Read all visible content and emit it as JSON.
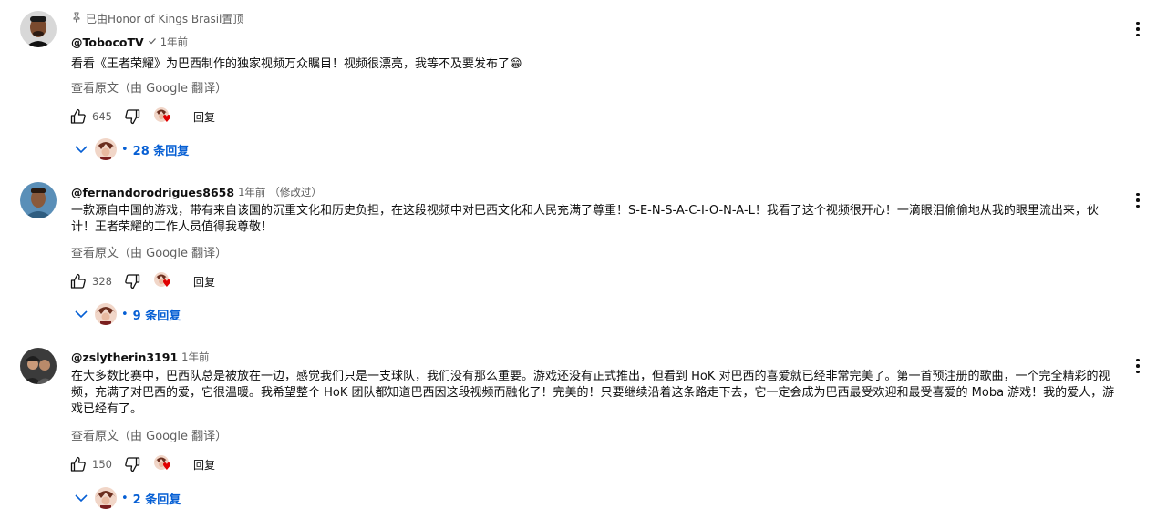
{
  "colors": {
    "link": "#065fd4",
    "secondary": "#606060",
    "primary": "#0f0f0f",
    "heart": "#e00000"
  },
  "comments": [
    {
      "pinned_text": "已由Honor of Kings Brasil置顶",
      "author": "@TobocoTV",
      "verified_icon": "check-icon",
      "time": "1年前",
      "edited": "",
      "text": "看看《王者荣耀》为巴西制作的独家视频万众瞩目！视频很漂亮，我等不及要发布了😁",
      "translate": "查看原文（由 Google 翻译）",
      "likes": "645",
      "reply_label": "回复",
      "replies": "28 条回复"
    },
    {
      "pinned_text": "",
      "author": "@fernandorodrigues8658",
      "time": "1年前",
      "edited": "（修改过）",
      "text": "一款源自中国的游戏，带有来自该国的沉重文化和历史负担，在这段视频中对巴西文化和人民充满了尊重！S-E-N-S-A-C-I-O-N-A-L！我看了这个视频很开心！一滴眼泪偷偷地从我的眼里流出来，伙计！王者荣耀的工作人员值得我尊敬！",
      "translate": "查看原文（由 Google 翻译）",
      "likes": "328",
      "reply_label": "回复",
      "replies": "9 条回复"
    },
    {
      "pinned_text": "",
      "author": "@zslytherin3191",
      "time": "1年前",
      "edited": "",
      "text": "在大多数比赛中，巴西队总是被放在一边，感觉我们只是一支球队，我们没有那么重要。游戏还没有正式推出，但看到 HoK 对巴西的喜爱就已经非常完美了。第一首预注册的歌曲，一个完全精彩的视频，充满了对巴西的爱，它很温暖。我希望整个 HoK 团队都知道巴西因这段视频而融化了！完美的！只要继续沿着这条路走下去，它一定会成为巴西最受欢迎和最受喜爱的 Moba 游戏！我的爱人，游戏已经有了。",
      "translate": "查看原文（由 Google 翻译）",
      "likes": "150",
      "reply_label": "回复",
      "replies": "2 条回复"
    }
  ]
}
